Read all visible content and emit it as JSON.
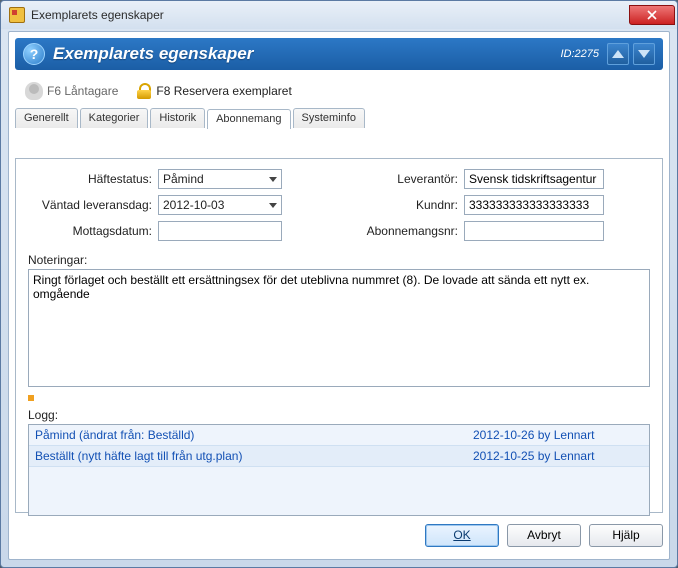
{
  "window": {
    "title": "Exemplarets egenskaper"
  },
  "banner": {
    "title": "Exemplarets egenskaper",
    "id_label": "ID:2275"
  },
  "toolbar": {
    "borrower_label": "F6 Låntagare",
    "reserve_label": "F8 Reservera exemplaret"
  },
  "tabs": {
    "generellt": "Generellt",
    "kategorier": "Kategorier",
    "historik": "Historik",
    "abonnemang": "Abonnemang",
    "systeminfo": "Systeminfo"
  },
  "fields": {
    "haftestatus_label": "Häftestatus:",
    "haftestatus_value": "Påmind",
    "vantad_label": "Väntad leveransdag:",
    "vantad_value": "2012-10-03",
    "mottag_label": "Mottagsdatum:",
    "mottag_value": "",
    "leverantor_label": "Leverantör:",
    "leverantor_value": "Svensk tidskriftsagentur",
    "kundnr_label": "Kundnr:",
    "kundnr_value": "333333333333333333",
    "abnr_label": "Abonnemangsnr:",
    "abnr_value": ""
  },
  "notes": {
    "label": "Noteringar:",
    "value": "Ringt förlaget och beställt ett ersättningsex för det uteblivna nummret (8). De lovade att sända ett nytt ex. omgående"
  },
  "log": {
    "label": "Logg:",
    "rows": [
      {
        "desc": "Påmind (ändrat från: Beställd)",
        "meta": "2012-10-26 by Lennart"
      },
      {
        "desc": "Beställt (nytt häfte lagt till från utg.plan)",
        "meta": "2012-10-25 by Lennart"
      }
    ]
  },
  "buttons": {
    "ok": "OK",
    "cancel": "Avbryt",
    "help": "Hjälp"
  }
}
